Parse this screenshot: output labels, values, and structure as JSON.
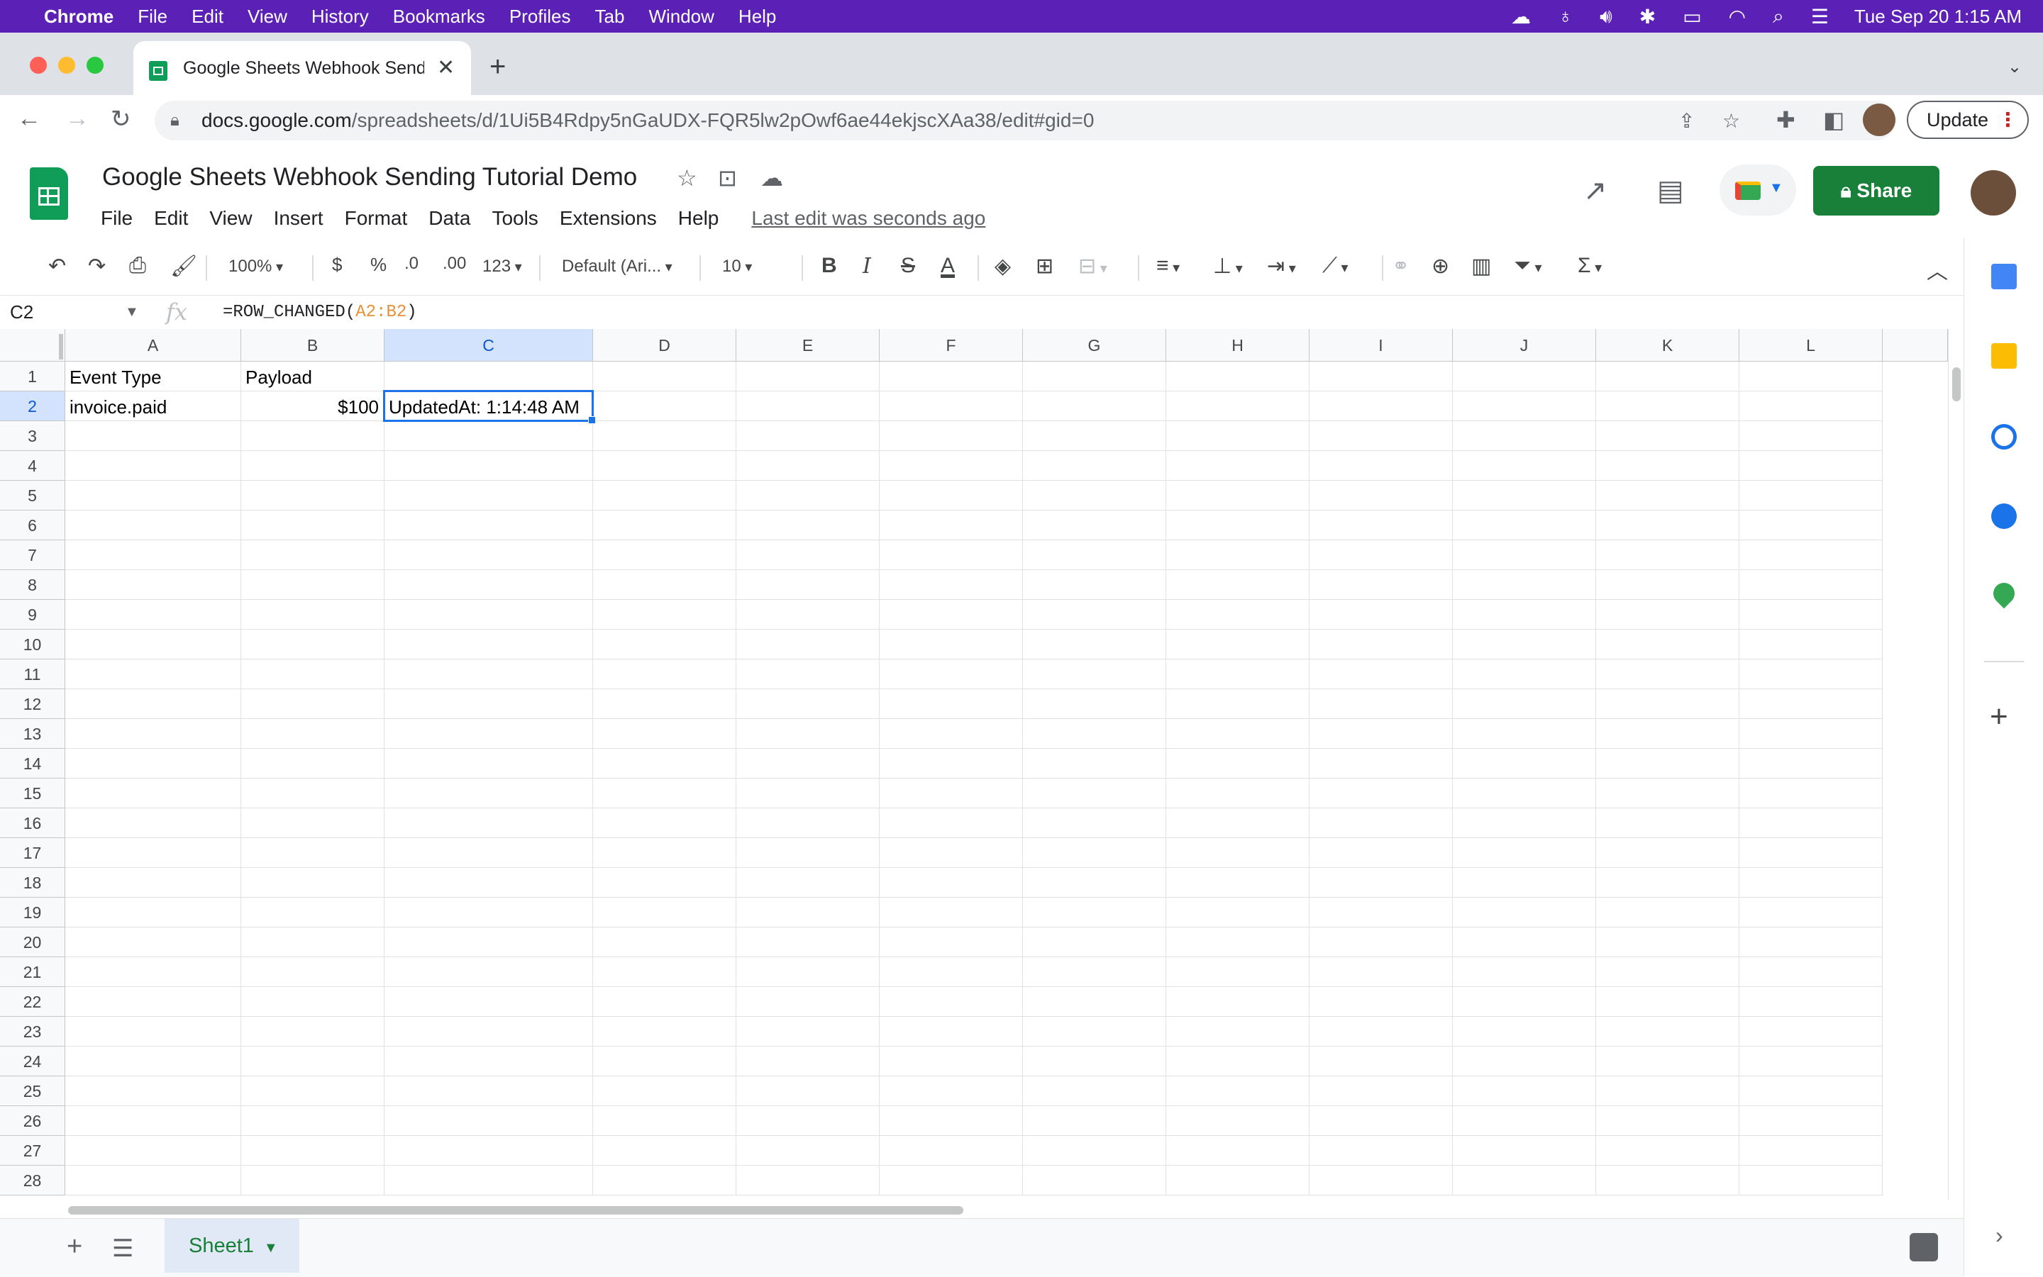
{
  "os_menubar": {
    "app": "Chrome",
    "items": [
      "File",
      "Edit",
      "View",
      "History",
      "Bookmarks",
      "Profiles",
      "Tab",
      "Window",
      "Help"
    ],
    "clock": "Tue Sep 20  1:15 AM"
  },
  "browser": {
    "tab_title": "Google Sheets Webhook Sending Tutorial Demo",
    "url_host": "docs.google.com",
    "url_path": "/spreadsheets/d/1Ui5B4Rdpy5nGaUDX-FQR5lw2pOwf6ae44ekjscXAa38/edit#gid=0",
    "update_label": "Update"
  },
  "doc": {
    "title": "Google Sheets Webhook Sending Tutorial Demo",
    "menu": [
      "File",
      "Edit",
      "View",
      "Insert",
      "Format",
      "Data",
      "Tools",
      "Extensions",
      "Help"
    ],
    "last_edit": "Last edit was seconds ago",
    "share_label": "Share"
  },
  "toolbar": {
    "zoom": "100%",
    "currency": "$",
    "percent": "%",
    "dec_decrease": ".0",
    "dec_increase": ".00",
    "more_formats": "123",
    "font": "Default (Ari...",
    "font_size": "10"
  },
  "formula_bar": {
    "cell_ref": "C2",
    "formula_prefix": "=ROW_CHANGED(",
    "formula_range": "A2:B2",
    "formula_suffix": ")"
  },
  "grid": {
    "columns": [
      "A",
      "B",
      "C",
      "D",
      "E",
      "F",
      "G",
      "H",
      "I",
      "J",
      "K",
      "L"
    ],
    "rows": [
      "1",
      "2",
      "3",
      "4",
      "5",
      "6",
      "7",
      "8",
      "9",
      "10",
      "11",
      "12",
      "13",
      "14",
      "15",
      "16",
      "17",
      "18",
      "19",
      "20",
      "21",
      "22",
      "23",
      "24",
      "25",
      "26",
      "27",
      "28"
    ],
    "cells": {
      "A1": "Event Type",
      "B1": "Payload",
      "A2": "invoice.paid",
      "B2": "$100",
      "C2": "UpdatedAt: 1:14:48 AM"
    },
    "selected_cell": "C2"
  },
  "sheets": {
    "active_tab": "Sheet1"
  }
}
